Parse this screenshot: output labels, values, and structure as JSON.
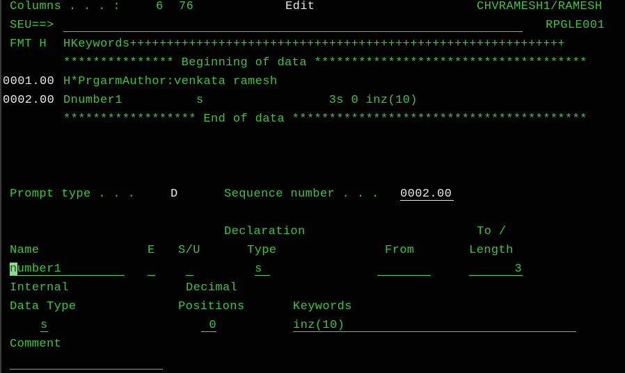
{
  "header": {
    "columns_label": "Columns . . . :",
    "columns_from": "6",
    "columns_to": "76",
    "mode": "Edit",
    "source_path": "CHVRAMESH1/RAMESH",
    "command_prompt": "SEU==>",
    "command_value": "",
    "member": "RPGLE001",
    "format_label": "FMT H",
    "format_ruler": "HKeywords+++++++++++++++++++++++++++++++++++++++++++++++++++++++++++"
  },
  "source": {
    "begin_marker": "*************** Beginning of data *************************************",
    "lines": [
      {
        "seq": "0001.00",
        "text": "H*PrgarmAuthor:venkata ramesh"
      },
      {
        "seq": "0002.00",
        "text": "Dnumber1          s                 3s 0 inz(10)"
      }
    ],
    "end_marker": "****************** End of data ****************************************"
  },
  "prompt": {
    "prompt_type_label": "Prompt type . . .",
    "prompt_type_value": "D",
    "sequence_label": "Sequence number . . .",
    "sequence_value": "0002.00",
    "declaration_heading": "Declaration",
    "to_heading": "To /",
    "columns": {
      "name": "Name",
      "e": "E",
      "su": "S/U",
      "type": "Type",
      "from": "From",
      "length": "Length"
    },
    "values": {
      "name_cursor_char": "n",
      "name_rest": "umber1",
      "e": "",
      "su": "",
      "type": "s",
      "from": "",
      "length": "3"
    },
    "internal_label": "Internal",
    "data_type_label": "Data Type",
    "decimal_label": "Decimal",
    "positions_label": "Positions",
    "keywords_label": "Keywords",
    "internal_data_type_value": "s",
    "decimal_positions_value": "0",
    "keywords_value": "inz(10)",
    "comment_label": "Comment",
    "comment_value": ""
  },
  "colors": {
    "background": "#020202",
    "text_green": "#3fc43f",
    "text_white": "#e8e8e8"
  }
}
